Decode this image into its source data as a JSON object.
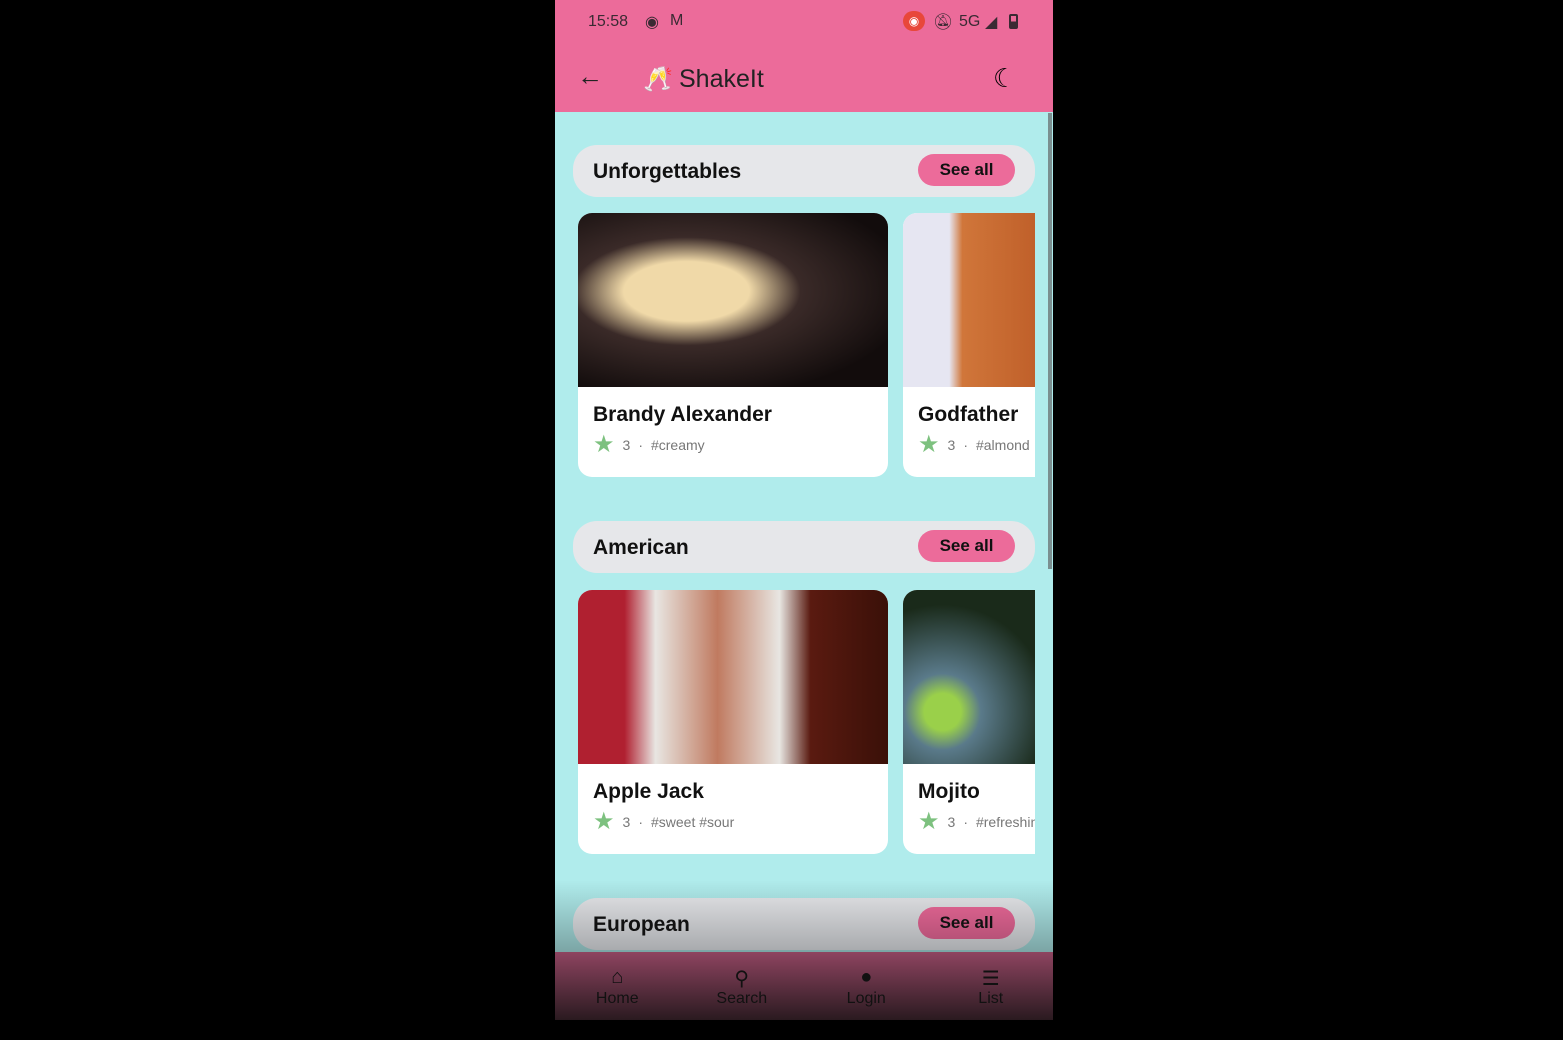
{
  "status": {
    "time": "15:58",
    "network": "5G"
  },
  "appbar": {
    "title": "ShakeIt",
    "logo": "🥂"
  },
  "sections": [
    {
      "title": "Unforgettables",
      "see_all": "See all",
      "cards": [
        {
          "name": "Brandy Alexander",
          "rating": "3",
          "tags": "#creamy"
        },
        {
          "name": "Godfather",
          "rating": "3",
          "tags": "#almond"
        }
      ]
    },
    {
      "title": "American",
      "see_all": "See all",
      "cards": [
        {
          "name": "Apple Jack",
          "rating": "3",
          "tags": "#sweet #sour"
        },
        {
          "name": "Mojito",
          "rating": "3",
          "tags": "#refreshing"
        }
      ]
    },
    {
      "title": "European",
      "see_all": "See all"
    }
  ],
  "nav": [
    {
      "label": "Home",
      "icon": "home-icon"
    },
    {
      "label": "Search",
      "icon": "search-icon"
    },
    {
      "label": "Login",
      "icon": "person-icon"
    },
    {
      "label": "List",
      "icon": "list-icon"
    }
  ],
  "colors": {
    "primary": "#ec6b9a",
    "background": "#b0ecec",
    "star": "#7dc17f"
  }
}
